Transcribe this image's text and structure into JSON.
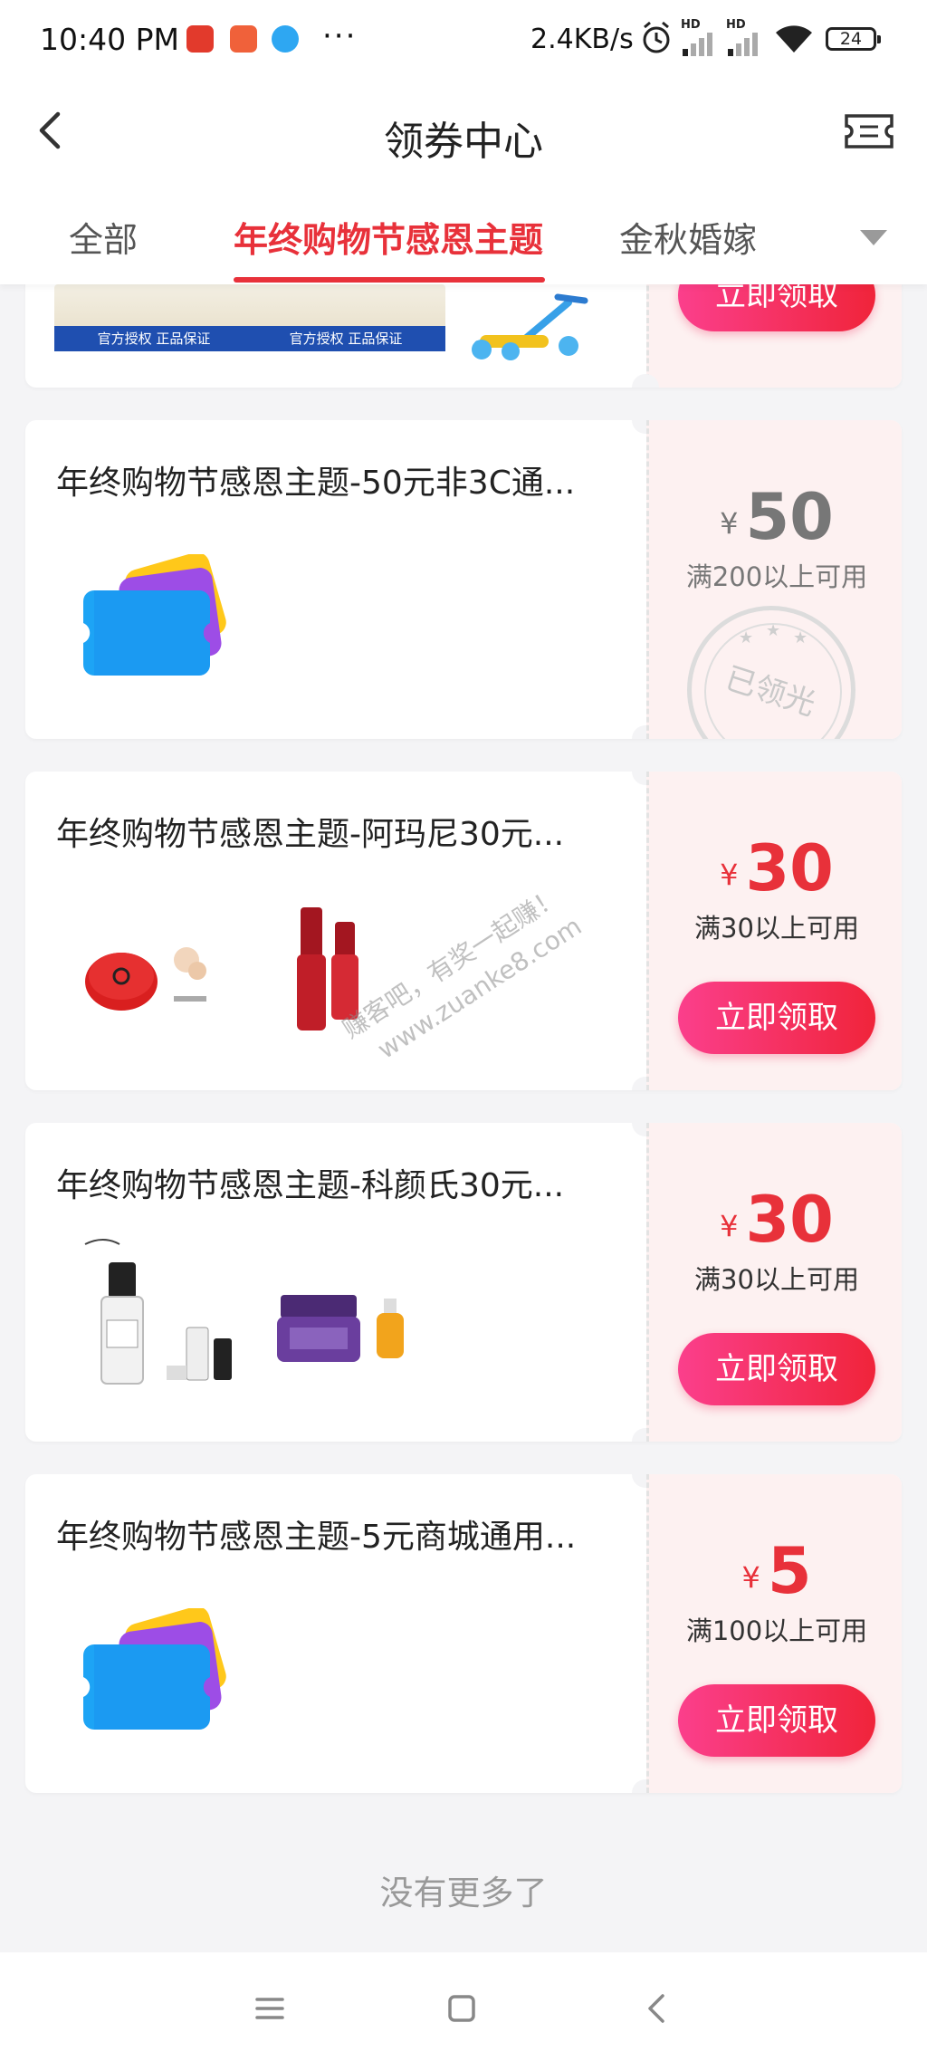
{
  "status_bar": {
    "time": "10:40 PM",
    "net_speed": "2.4KB/s",
    "network_badge_1": "HD",
    "network_badge_2": "HD",
    "battery": "24",
    "more_dots": "···"
  },
  "header": {
    "title": "领券中心"
  },
  "tabs": [
    {
      "label": "全部",
      "active": false
    },
    {
      "label": "年终购物节感恩主题",
      "active": true
    },
    {
      "label": "金秋婚嫁",
      "active": false
    }
  ],
  "top_coupon": {
    "badge_1": "官方授权 正品保证",
    "badge_2": "官方授权 正品保证",
    "claim_label": "立即领取"
  },
  "coupons": [
    {
      "title": "年终购物节感恩主题-50元非3C通...",
      "currency": "¥",
      "amount": "50",
      "condition": "满200以上可用",
      "status": "已领光"
    },
    {
      "title": "年终购物节感恩主题-阿玛尼30元...",
      "currency": "¥",
      "amount": "30",
      "condition": "满30以上可用",
      "claim_label": "立即领取"
    },
    {
      "title": "年终购物节感恩主题-科颜氏30元...",
      "currency": "¥",
      "amount": "30",
      "condition": "满30以上可用",
      "claim_label": "立即领取"
    },
    {
      "title": "年终购物节感恩主题-5元商城通用...",
      "currency": "¥",
      "amount": "5",
      "condition": "满100以上可用",
      "claim_label": "立即领取"
    }
  ],
  "footer": {
    "text": "没有更多了"
  },
  "watermark": {
    "line1": "赚客吧，有奖一起赚！",
    "line2": "www.zuanke8.com"
  },
  "colors": {
    "accent": "#e8313a",
    "button_start": "#fb3f8c",
    "button_end": "#f0243a",
    "coupon_right_bg": "#fdf1f1",
    "page_bg": "#f4f4f6"
  },
  "icons": [
    "back-arrow-icon",
    "ticket-icon",
    "dropdown-triangle-icon",
    "alarm-icon",
    "signal-icon",
    "wifi-icon",
    "menu-icon",
    "home-square-icon",
    "nav-back-icon"
  ]
}
